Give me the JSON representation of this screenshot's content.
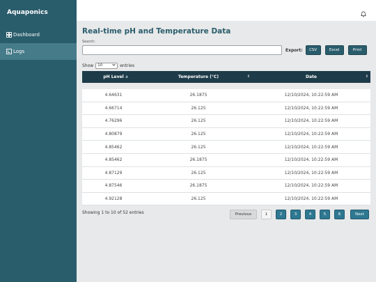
{
  "app": {
    "brand": "Aquaponics"
  },
  "sidebar": {
    "items": [
      {
        "label": "Dashboard",
        "icon": "dashboard-icon",
        "active": false
      },
      {
        "label": "Logs",
        "icon": "logs-icon",
        "active": true
      }
    ]
  },
  "header": {
    "icon": "bell-icon"
  },
  "main": {
    "title": "Real-time pH and Temperature Data",
    "search": {
      "label": "Search:",
      "value": "",
      "placeholder": ""
    },
    "export": {
      "label": "Export:",
      "buttons": [
        "CSV",
        "Excel",
        "Print"
      ]
    },
    "length": {
      "prefix": "Show",
      "selected": "10",
      "suffix": "entries"
    },
    "table": {
      "columns": [
        "pH Level",
        "Temperature (°C)",
        "Date"
      ],
      "sort_icons": [
        "▲",
        "⇕",
        "⇕"
      ],
      "rows": [
        [
          "4.64631",
          "26.1875",
          "12/10/2024, 10:22:59 AM"
        ],
        [
          "4.66714",
          "26.125",
          "12/10/2024, 10:22:59 AM"
        ],
        [
          "4.76296",
          "26.125",
          "12/10/2024, 10:22:59 AM"
        ],
        [
          "4.80879",
          "26.125",
          "12/10/2024, 10:22:59 AM"
        ],
        [
          "4.85462",
          "26.125",
          "12/10/2024, 10:22:59 AM"
        ],
        [
          "4.85462",
          "26.1875",
          "12/10/2024, 10:22:59 AM"
        ],
        [
          "4.87129",
          "26.125",
          "12/10/2024, 10:22:59 AM"
        ],
        [
          "4.87546",
          "26.1875",
          "12/10/2024, 10:22:59 AM"
        ],
        [
          "4.92128",
          "26.125",
          "12/10/2024, 10:22:59 AM"
        ]
      ]
    },
    "info": "Showing 1 to 10 of 52 entries",
    "pagination": {
      "previous": "Previous",
      "pages": [
        "1",
        "2",
        "3",
        "4",
        "5",
        "6"
      ],
      "current": "1",
      "next": "Next"
    }
  },
  "colors": {
    "sidebar": "#2a5d6c",
    "sidebar_active": "#467b89",
    "table_header": "#1e3b49",
    "accent": "#2a5d6c",
    "page_button": "#2f7891",
    "background": "#e8e9ea"
  }
}
